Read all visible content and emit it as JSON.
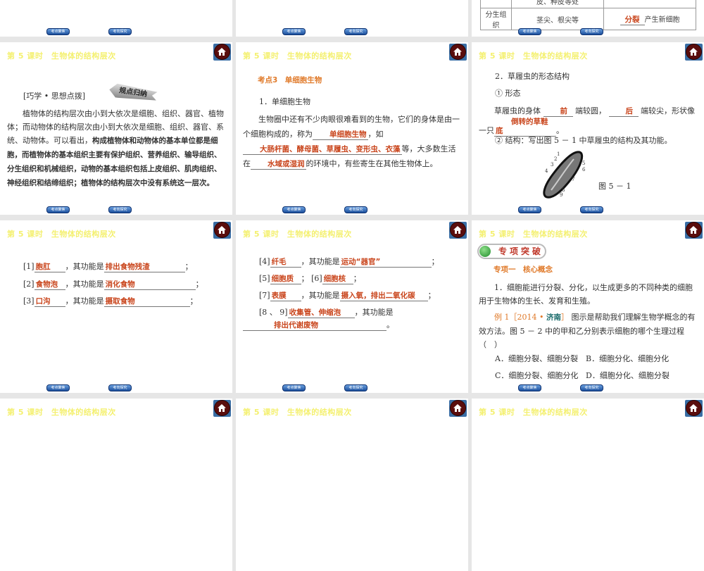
{
  "header": {
    "title": "第 5 课时　生物体的结构层次"
  },
  "nav": {
    "prev": "考点聚焦",
    "next": "考向探究"
  },
  "slide_top_right": {
    "rows": [
      [
        "",
        "皮、种皮等处",
        ""
      ],
      [
        "分生组织",
        "茎尖、根尖等",
        "产生新细胞"
      ]
    ],
    "answer": "分裂"
  },
  "slide_tips": {
    "label": "[巧学 • 思想点拨]",
    "badge": "规点归纳",
    "text1": "植物体的结构层次由小到大依次是细胞、组织、器官、植物体；而动物体的结构层次由小到大依次是细胞、组织、器官、系统、动物体。可以看出，",
    "text2": "构成植物体和动物体的基本单位都是细胞，而植物体的基本组织主要有保护组织、营养组织、输导组织、分生组织和机械组织，动物的基本组织包括上皮组织、肌肉组织、神经组织和结缔组织；植物体的结构层次中没有系统这一层次。"
  },
  "slide_single": {
    "heading": "考点3　单细胞生物",
    "sub": "1．单细胞生物",
    "p1": "生物圈中还有不少肉眼很难看到的生物，它们的身体是由一个细胞构成的，称为",
    "a1": "单细胞生物",
    "p2": "，如",
    "a2": "大肠杆菌、酵母菌、草履虫、变形虫、衣藻",
    "p3": "等，大多数生活在",
    "a3": "水域或湿润",
    "p4": "的环境中，有些寄生在其他生物体上。"
  },
  "slide_paramecium": {
    "heading": "2．草履虫的形态结构",
    "form": "① 形态",
    "l1": "草履虫的身体",
    "a1": "前",
    "l2": "端较圆，",
    "a2": "后",
    "l3": "端较尖，形状像一只",
    "a3": "倒转的草鞋底",
    "l4": "。",
    "struct": "② 结构：写出图 5 － 1 中草履虫的结构及其功能。",
    "fig": "图 5 － 1",
    "labels": [
      "1",
      "2",
      "3",
      "4",
      "5",
      "6",
      "7",
      "8",
      "9"
    ]
  },
  "slide_parts1": {
    "func": "，其功能是",
    "items": [
      {
        "n": "[1]",
        "name": "胞肛",
        "fn": "排出食物残渣",
        "end": "；"
      },
      {
        "n": "[2]",
        "name": "食物泡",
        "fn": "消化食物",
        "end": "；"
      },
      {
        "n": "[3]",
        "name": "口沟",
        "fn": "摄取食物",
        "end": "；"
      }
    ]
  },
  "slide_parts2": {
    "func": "，其功能是",
    "n4": "[4]",
    "a4": "纤毛",
    "f4": "运动“器官”",
    "n5": "[5]",
    "a5": "细胞质",
    "n6": "[6]",
    "a6": "细胞核",
    "n7": "[7]",
    "a7": "表膜",
    "f7": "摄入氧，排出二氧化碳",
    "n89": "[8 、 9]",
    "a89": "收集管、伸缩泡",
    "f89": "排出代谢废物",
    "semi": "；",
    "end": "。"
  },
  "slide_special": {
    "banner": "专项突破",
    "topic": "专项一　核心概念",
    "p1": "1．细胞能进行分裂、分化，以生成更多的不同种类的细胞用于生物体的生长、发育和生殖。",
    "ex_label": "例 1［2014 • ",
    "ex_city": "济南",
    "ex_close": "］",
    "ex_text": "图示是帮助我们理解生物学概念的有效方法。图 5 － 2 中的甲和乙分别表示细胞的哪个生理过程（　）",
    "options": [
      "A．细胞分裂、细胞分裂",
      "B．细胞分化、细胞分化",
      "C．细胞分裂、细胞分化",
      "D．细胞分化、细胞分裂"
    ]
  }
}
